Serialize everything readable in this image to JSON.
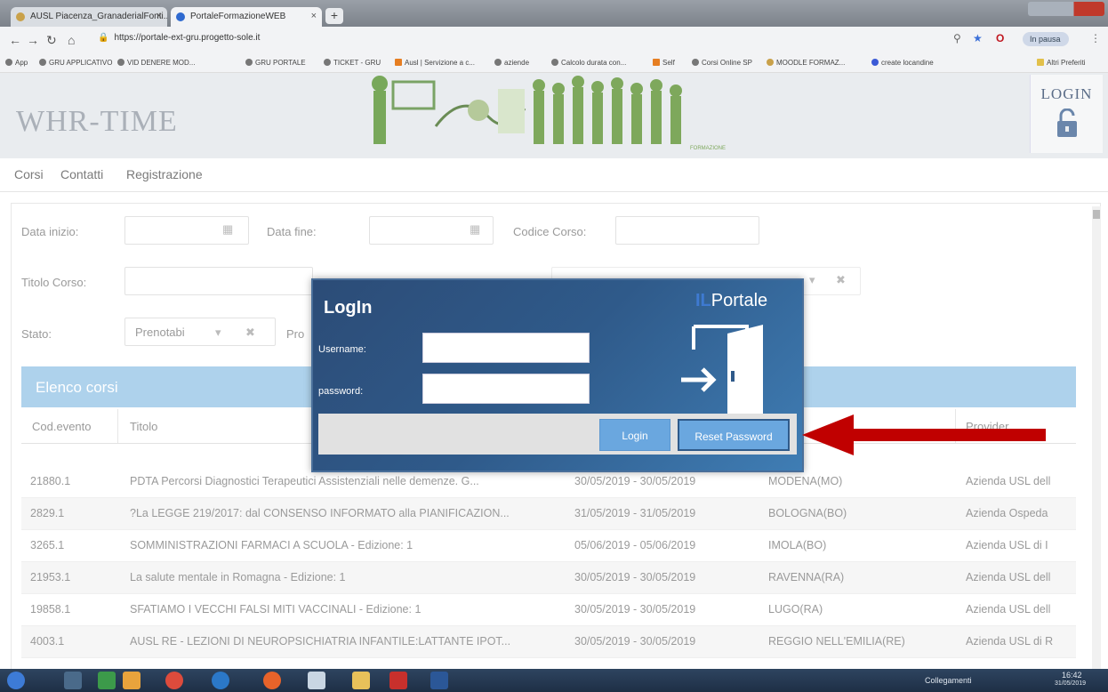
{
  "browser": {
    "tabs": [
      {
        "title": "AUSL Piacenza_GranaderialFonti..."
      },
      {
        "title": "PortaleFormazioneWEB"
      }
    ],
    "new_tab_label": "+",
    "url": "https://portale-ext-gru.progetto-sole.it",
    "bookmarks": [
      "App",
      "GRU APPLICATIVO",
      "VID DENERE MOD...",
      "GRU PORTALE",
      "TICKET - GRU",
      "Ausl | Servizione a c...",
      "aziende",
      "Calcolo durata con...",
      "Self",
      "Corsi Online SP",
      "MOODLE FORMAZ...",
      "create locandine",
      "Altri Preferiti"
    ],
    "pause_label": "In pausa"
  },
  "header": {
    "brand": "WHR-TIME",
    "banner_caption": "FORMAZIONE",
    "login_label": "LOGIN"
  },
  "topnav": {
    "items": [
      "Corsi",
      "Contatti",
      "Registrazione"
    ]
  },
  "filters": {
    "data_inizio": "Data inizio:",
    "data_fine": "Data fine:",
    "codice_corso": "Codice Corso:",
    "titolo_corso": "Titolo Corso:",
    "stato": "Stato:",
    "stato_value": "Prenotabi",
    "pro": "Pro",
    "clear_glyph": "✖"
  },
  "list": {
    "title": "Elenco corsi",
    "columns": [
      "Cod.evento",
      "Titolo",
      "Provider"
    ],
    "rows": [
      {
        "cod": "21880.1",
        "titolo": "PDTA Percorsi Diagnostici Terapeutici Assistenziali nelle demenze. G...",
        "date": "30/05/2019 - 30/05/2019",
        "luogo": "MODENA(MO)",
        "provider": "Azienda USL dell"
      },
      {
        "cod": "2829.1",
        "titolo": "?La LEGGE 219/2017: dal CONSENSO INFORMATO alla PIANIFICAZION...",
        "date": "31/05/2019 - 31/05/2019",
        "luogo": "BOLOGNA(BO)",
        "provider": "Azienda Ospeda"
      },
      {
        "cod": "3265.1",
        "titolo": "SOMMINISTRAZIONI FARMACI A SCUOLA - Edizione: 1",
        "date": "05/06/2019 - 05/06/2019",
        "luogo": "IMOLA(BO)",
        "provider": "Azienda USL di I"
      },
      {
        "cod": "21953.1",
        "titolo": "La salute mentale in Romagna - Edizione: 1",
        "date": "30/05/2019 - 30/05/2019",
        "luogo": "RAVENNA(RA)",
        "provider": "Azienda USL dell"
      },
      {
        "cod": "19858.1",
        "titolo": "SFATIAMO I VECCHI FALSI MITI VACCINALI - Edizione: 1",
        "date": "30/05/2019 - 30/05/2019",
        "luogo": "LUGO(RA)",
        "provider": "Azienda USL dell"
      },
      {
        "cod": "4003.1",
        "titolo": "AUSL RE - LEZIONI DI NEUROPSICHIATRIA INFANTILE:LATTANTE IPOT...",
        "date": "30/05/2019 - 30/05/2019",
        "luogo": "REGGIO NELL'EMILIA(RE)",
        "provider": "Azienda USL di R"
      }
    ]
  },
  "modal": {
    "title": "LogIn",
    "brand_il": "IL",
    "brand_rest": "Portale",
    "username_label": "Username:",
    "password_label": "password:",
    "username_value": "",
    "password_value": "",
    "login_button": "Login",
    "reset_button": "Reset Password"
  },
  "taskbar": {
    "network_label": "Collegamenti",
    "time": "16:42",
    "date": "31/05/2019"
  },
  "colors": {
    "modal_dark": "#2c4c77",
    "button_blue": "#6aa7df",
    "list_header": "#aed2ec",
    "arrow_red": "#c00000"
  }
}
